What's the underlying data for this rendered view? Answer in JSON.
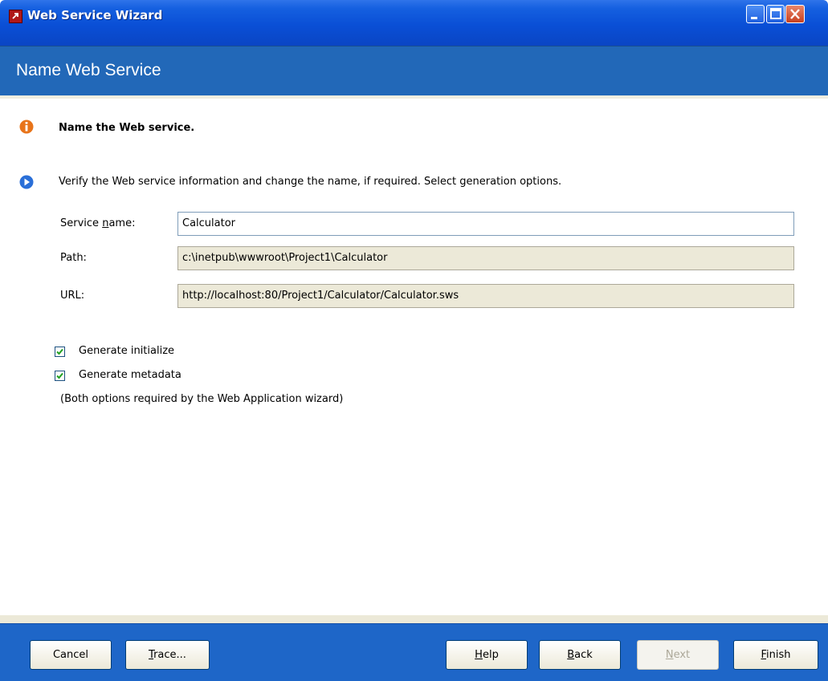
{
  "window": {
    "title": "Web Service Wizard",
    "controls": [
      "minimize-icon",
      "maximize-icon",
      "close-icon"
    ]
  },
  "header": {
    "title": "Name Web Service"
  },
  "message": {
    "title": "Name the Web service.",
    "instructions": "Verify the Web service information and change the name, if required. Select generation options."
  },
  "form": {
    "service_name": {
      "label_pre": "Service ",
      "label_mnemonic": "n",
      "label_post": "ame:",
      "value": "Calculator"
    },
    "path": {
      "label": "Path:",
      "value": "c:\\inetpub\\wwwroot\\Project1\\Calculator"
    },
    "url": {
      "label": "URL:",
      "value": "http://localhost:80/Project1/Calculator/Calculator.sws"
    }
  },
  "options": {
    "generate_initialize": {
      "label": "Generate initialize",
      "checked": true
    },
    "generate_metadata": {
      "label": "Generate metadata",
      "checked": true
    },
    "note": "(Both options required by the Web Application wizard)"
  },
  "buttons": {
    "cancel": {
      "label": "Cancel"
    },
    "trace": {
      "mnemonic": "T",
      "rest": "race..."
    },
    "help": {
      "mnemonic": "H",
      "rest": "elp"
    },
    "back": {
      "mnemonic": "B",
      "rest": "ack"
    },
    "next": {
      "mnemonic": "N",
      "rest": "ext",
      "enabled": false
    },
    "finish": {
      "mnemonic": "F",
      "rest": "inish"
    }
  },
  "colors": {
    "title_bar": "#0a4fd6",
    "header_band": "#2268b8",
    "bottom_bar": "#1e66c8",
    "info_icon": "#e8741a",
    "arrow_icon": "#2a6fd8",
    "checkmark": "#21a121"
  }
}
